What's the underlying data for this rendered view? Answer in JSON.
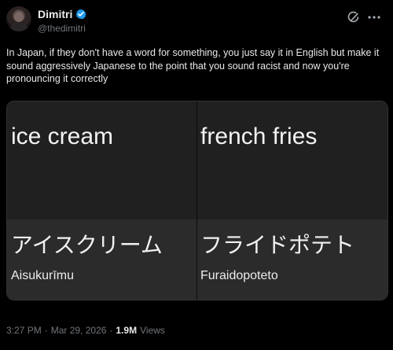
{
  "user": {
    "display_name": "Dimitri",
    "handle": "@thedimitri"
  },
  "post": {
    "text": "In Japan, if they don't have a word for something, you just say it in English but make it sound aggressively Japanese to the point that you sound racist and now you're pronouncing it correctly",
    "media": {
      "panels": [
        {
          "english": "ice cream",
          "japanese": "アイスクリーム",
          "romaji": "Aisukurīmu"
        },
        {
          "english": "french fries",
          "japanese": "フライドポテト",
          "romaji": "Furaidopoteto"
        }
      ]
    },
    "meta": {
      "time": "3:27 PM",
      "separator1": "·",
      "date": "Mar 29, 2026",
      "separator2": "·",
      "views_count": "1.9M",
      "views_label": "Views"
    }
  },
  "icons": {
    "verified": "verified-badge-icon",
    "grok": "grok-icon",
    "more": "more-icon"
  },
  "colors": {
    "background": "#000000",
    "text_primary": "#e7e9ea",
    "text_secondary": "#71767b",
    "verified": "#1d9bf0"
  }
}
